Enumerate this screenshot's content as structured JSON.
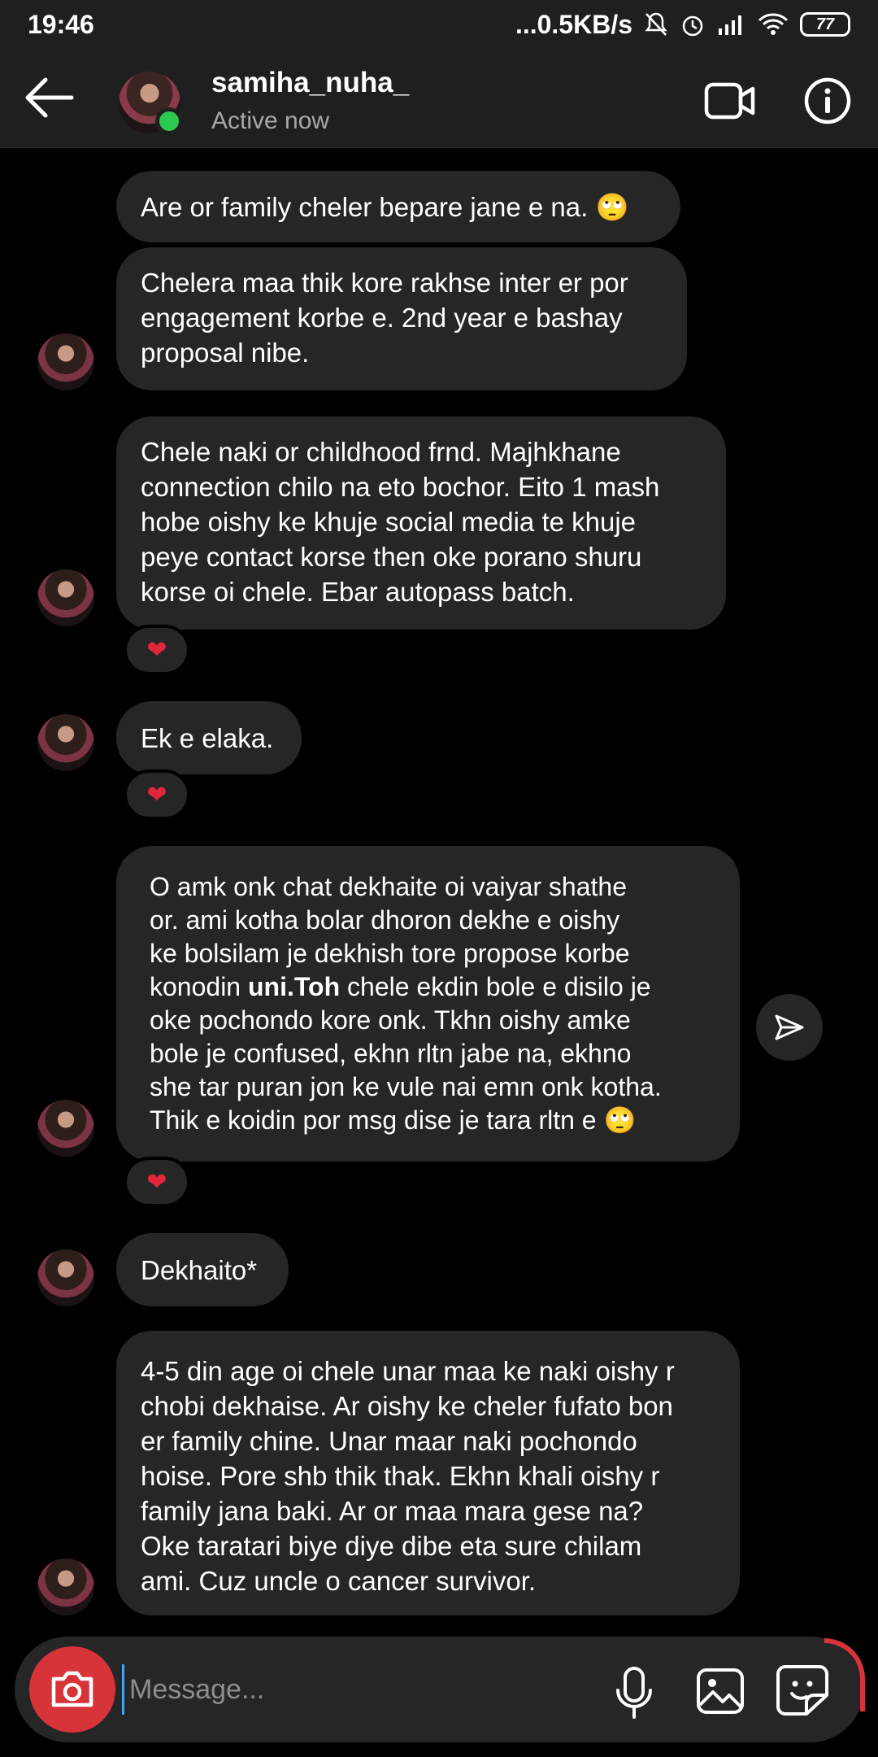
{
  "statusbar": {
    "time": "19:46",
    "network_speed": "...0.5KB/s",
    "battery": "77"
  },
  "header": {
    "username": "samiha_nuha_",
    "status": "Active now"
  },
  "messages": [
    {
      "text": "Are or family cheler bepare jane e na. 🙄"
    },
    {
      "text": "Chelera maa thik kore rakhse inter er por\nengagement korbe e. 2nd year e bashay\nproposal nibe."
    },
    {
      "text": "Chele naki or childhood frnd. Majhkhane\nconnection chilo na eto bochor. Eito 1 mash\nhobe oishy ke khuje social media te khuje\npeye contact korse then oke porano shuru\nkorse oi chele. Ebar autopass batch.",
      "reaction": "❤"
    },
    {
      "text": "Ek e elaka.",
      "reaction": "❤"
    },
    {
      "text_before": "O amk onk chat dekhaite oi vaiyar shathe\nor. ami kotha bolar dhoron dekhe e oishy\nke bolsilam je dekhish tore propose korbe\nkonodin ",
      "text_bold": "uni.Toh",
      "text_after": " chele ekdin bole e disilo je\noke pochondo kore onk. Tkhn oishy amke\nbole je confused, ekhn rltn jabe na, ekhno\nshe tar puran jon ke vule nai emn onk kotha.\nThik e koidin por msg dise je tara rltn e 🙄",
      "reaction": "❤"
    },
    {
      "text": "Dekhaito*"
    },
    {
      "text": "4-5 din age oi chele unar maa ke naki oishy r\nchobi dekhaise. Ar oishy ke cheler fufato bon\ner family chine. Unar maar naki pochondo\nhoise. Pore shb thik thak. Ekhn khali oishy r\nfamily jana baki. Ar or maa mara gese na?\nOke taratari biye diye dibe eta sure chilam\nami. Cuz uncle o cancer survivor."
    }
  ],
  "composer": {
    "placeholder": "Message..."
  },
  "icons": {
    "back": "arrow-left-icon",
    "video": "video-camera-icon",
    "info": "info-icon",
    "share": "send-icon",
    "camera": "camera-icon",
    "mic": "microphone-icon",
    "gallery": "image-icon",
    "sticker": "sticker-icon"
  },
  "colors": {
    "background": "#000000",
    "bubble": "#262626",
    "online": "#2dc94f",
    "camera_button": "#d7343a",
    "heart": "#e0263a"
  }
}
